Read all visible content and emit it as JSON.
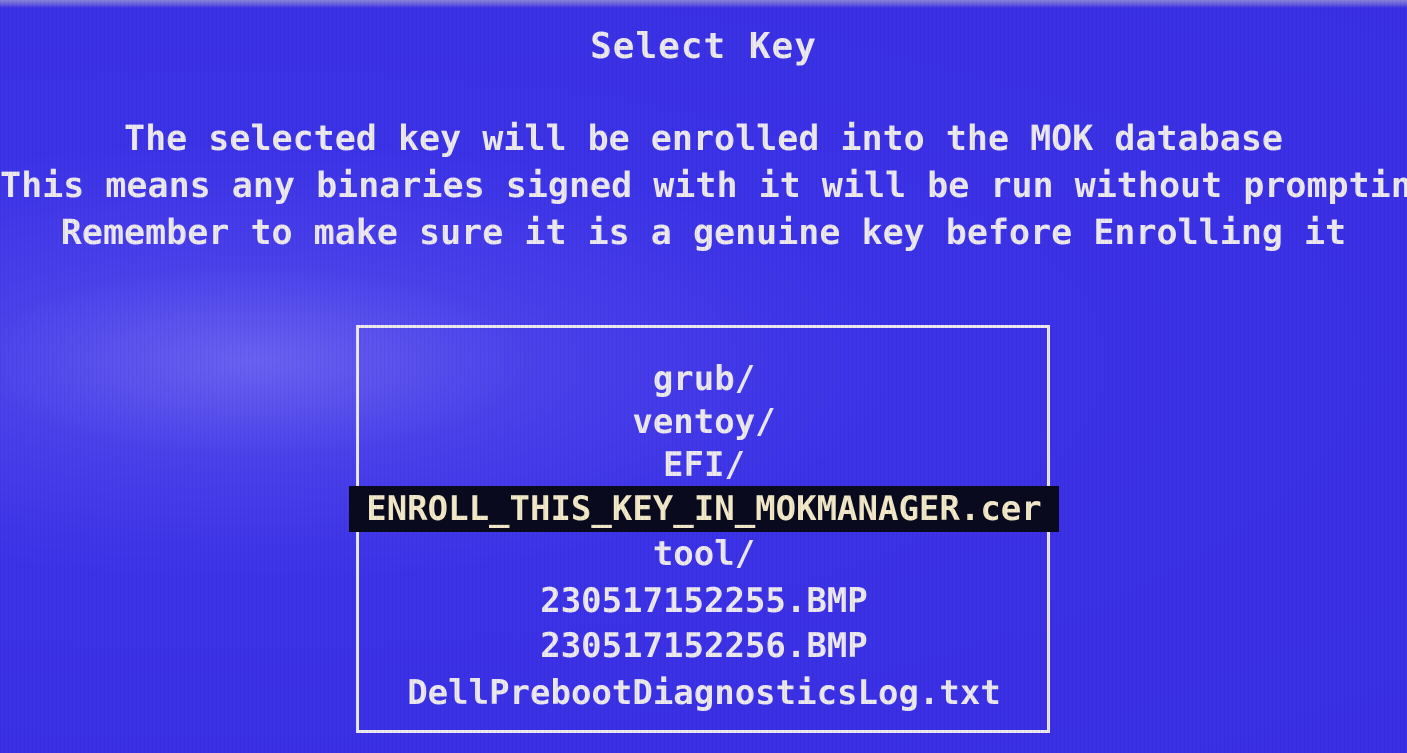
{
  "title": "Select Key",
  "message_lines": [
    "The selected key will be enrolled into the MOK database",
    "This means any binaries signed with it will be run without prompting",
    "Remember to make sure it is a genuine key before Enrolling it"
  ],
  "entries": [
    "grub/",
    "ventoy/",
    "EFI/",
    "ENROLL_THIS_KEY_IN_MOKMANAGER.cer",
    "tool/",
    "230517152255.BMP",
    "230517152256.BMP",
    "DellPrebootDiagnosticsLog.txt"
  ],
  "selected_entry": "ENROLL_THIS_KEY_IN_MOKMANAGER.cer",
  "colors": {
    "background": "#3a2fe6",
    "text": "#ece8ee",
    "selection_background": "#0a0a1e",
    "selection_text": "#f2e8c8"
  }
}
